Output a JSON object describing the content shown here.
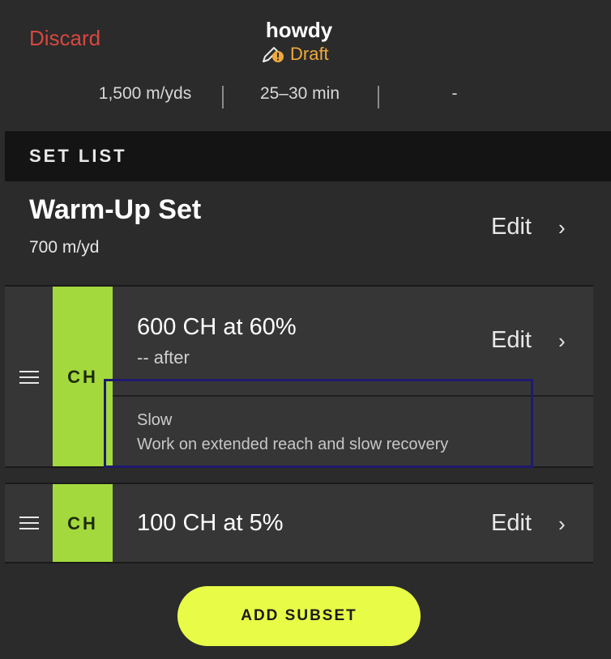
{
  "header": {
    "discard_label": "Discard",
    "title": "howdy",
    "status": "Draft",
    "status_icon": "pencil-warning-icon",
    "status_color": "#f0a93a",
    "discard_color": "#d9473f"
  },
  "stats": {
    "distance": "1,500 m/yds",
    "duration": "25–30 min",
    "other": "-"
  },
  "set_list": {
    "heading": "SET LIST"
  },
  "warmup": {
    "name": "Warm-Up Set",
    "distance": "700 m/yd",
    "edit_label": "Edit"
  },
  "subsets": [
    {
      "stroke": "CH",
      "title": "600 CH at 60%",
      "desc": "-- after",
      "edit_label": "Edit",
      "note_title": "Slow",
      "note_text": "Work on extended reach and slow recovery"
    },
    {
      "stroke": "CH",
      "title": "100 CH at 5%",
      "edit_label": "Edit"
    }
  ],
  "add_button": {
    "label": "ADD SUBSET",
    "color": "#e8fc47"
  },
  "accent_colors": {
    "stroke_tab": "#a3d93d"
  }
}
